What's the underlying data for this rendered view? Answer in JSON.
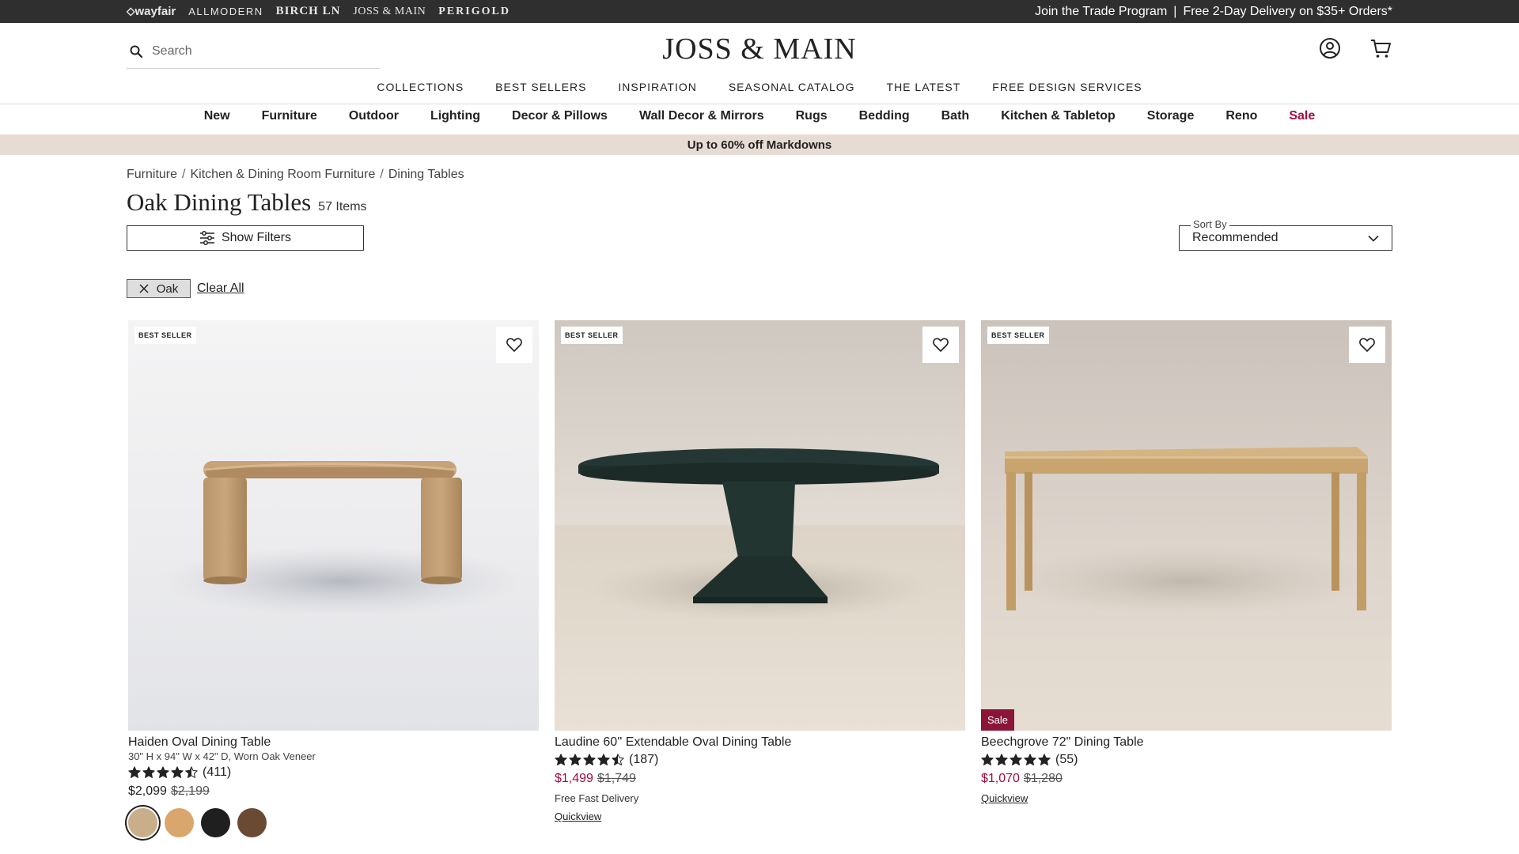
{
  "brands": {
    "wayfair": "wayfair",
    "allmodern": "ALLMODERN",
    "birch": "BIRCH LN",
    "joss": "JOSS & MAIN",
    "perigold": "PERIGOLD"
  },
  "promo": {
    "trade": "Join the Trade Program",
    "separator": "|",
    "delivery": "Free 2-Day Delivery on $35+ Orders*"
  },
  "header": {
    "logo": "JOSS & MAIN",
    "search_placeholder": "Search",
    "icons": [
      "account-icon",
      "cart-icon"
    ]
  },
  "primary_nav": [
    "COLLECTIONS",
    "BEST SELLERS",
    "INSPIRATION",
    "SEASONAL CATALOG",
    "THE LATEST",
    "FREE DESIGN SERVICES"
  ],
  "category_nav": [
    "New",
    "Furniture",
    "Outdoor",
    "Lighting",
    "Decor & Pillows",
    "Wall Decor & Mirrors",
    "Rugs",
    "Bedding",
    "Bath",
    "Kitchen & Tabletop",
    "Storage",
    "Reno",
    "Sale"
  ],
  "banner": "Up to 60% off Markdowns",
  "breadcrumb": [
    "Furniture",
    "Kitchen & Dining Room Furniture",
    "Dining Tables"
  ],
  "breadcrumb_separator": "/",
  "page": {
    "title": "Oak Dining Tables",
    "item_count": "57 Items"
  },
  "filters": {
    "show_label": "Show Filters",
    "sort_label": "Sort By",
    "sort_value": "Recommended",
    "active_chip": "Oak",
    "clear_all": "Clear All"
  },
  "products": [
    {
      "badge": "BEST SELLER",
      "name": "Haiden Oval Dining Table",
      "dims": "30\" H x 94\" W x 42\" D, Worn Oak Veneer",
      "rating": 4.5,
      "reviews": "(411)",
      "price": "$2,099",
      "original": "$2,199",
      "swatches": [
        "#c9ae8a",
        "#d9a66e",
        "#1f1f1f",
        "#6a4a33"
      ]
    },
    {
      "badge": "BEST SELLER",
      "name": "Laudine 60'' Extendable Oval Dining Table",
      "rating": 4.5,
      "reviews": "(187)",
      "price": "$1,499",
      "original": "$1,749",
      "delivery": "Free Fast Delivery",
      "quickview": "Quickview"
    },
    {
      "badge": "BEST SELLER",
      "sale_badge": "Sale",
      "name": "Beechgrove 72\" Dining Table",
      "rating": 5,
      "reviews": "(55)",
      "price": "$1,070",
      "original": "$1,280",
      "quickview": "Quickview"
    }
  ],
  "colors": {
    "topbar": "#2f2f2f",
    "sale_red": "#a10d3f",
    "banner_bg": "#e6dcd3",
    "sale_badge": "#8a1538"
  }
}
